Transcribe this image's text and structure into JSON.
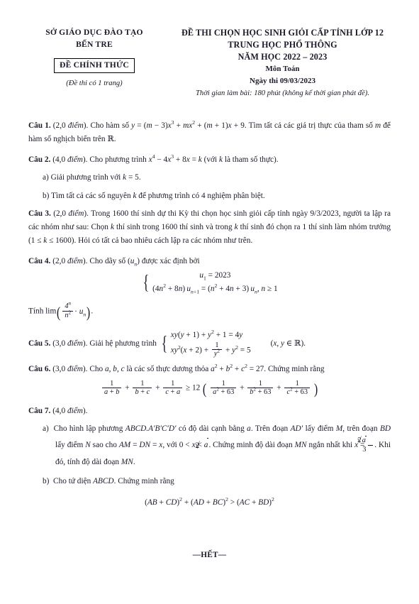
{
  "header": {
    "dept_line1": "SỞ GIÁO DỤC ĐÀO TẠO",
    "dept_line2": "BẾN TRE",
    "official_badge": "ĐỀ CHÍNH THỨC",
    "pages_note": "(Đề thi có 1 trang)",
    "exam_line1": "ĐỀ THI CHỌN HỌC SINH GIỎI CẤP TỈNH LỚP 12",
    "exam_line2": "TRUNG HỌC PHỔ THÔNG",
    "school_year": "NĂM HỌC 2022 – 2023",
    "subject": "Môn Toán",
    "exam_date": "Ngày thi 09/03/2023",
    "duration_note": "Thời gian làm bài: 180 phút (không kể thời gian phát đề)."
  },
  "questions": {
    "q1": {
      "label": "Câu 1.",
      "points": "(2,0 điểm).",
      "text_a": "Cho hàm số",
      "formula": "y = (m − 3)x³ + mx² + (m + 1)x + 9.",
      "text_b": "Tìm tất cả các giá trị thực của tham số m để hàm số nghịch biến trên ℝ."
    },
    "q2": {
      "label": "Câu 2.",
      "points": "(4,0 điểm).",
      "text_a": "Cho phương trình",
      "formula": "x⁴ − 4x³ + 8x = k",
      "text_b": "(với k là tham số thực).",
      "a": "a) Giải phương trình với k = 5.",
      "b": "b) Tìm tất cả các số nguyên k để phương trình có 4 nghiệm phân biệt."
    },
    "q3": {
      "label": "Câu 3.",
      "points": "(2,0 điểm).",
      "text": "Trong 1600 thí sinh dự thi Kỳ thi chọn học sinh giỏi cấp tỉnh ngày 9/3/2023, người ta lập ra các nhóm như sau: Chọn k thí sinh trong 1600 thí sinh và trong k thí sinh đó chọn ra 1 thí sinh làm nhóm trưởng (1 ≤ k ≤ 1600). Hỏi có tất cả bao nhiêu cách lập ra các nhóm như trên."
    },
    "q4": {
      "label": "Câu 4.",
      "points": "(2,0 điểm).",
      "text": "Cho dãy số (uₙ) được xác định bởi",
      "system_row1": "u₁ = 2023",
      "system_row2": "(4n² + 8n) uₙ₊₁ = (n² + 4n + 3) uₙ, n ≥ 1",
      "limit_prompt": "Tính lim",
      "limit_expr": "(4ⁿ / n² · uₙ)."
    },
    "q5": {
      "label": "Câu 5.",
      "points": "(3,0 điểm).",
      "text": "Giải hệ phương trình",
      "system_row1": "xy(y + 1) + y² + 1 = 4y",
      "system_row2": "xy²(x + 2) + 1/y² + y² = 5",
      "domain": "(x, y ∈ ℝ)."
    },
    "q6": {
      "label": "Câu 6.",
      "points": "(3,0 điểm).",
      "text": "Cho a, b, c là các số thực dương thỏa a² + b² + c² = 27. Chứng minh rằng",
      "inequality": "1/(a+b) + 1/(b+c) + 1/(c+a) ≥ 12 ( 1/(a²+63) + 1/(b²+63) + 1/(c²+63) )"
    },
    "q7": {
      "label": "Câu 7.",
      "points": "(4,0 điểm).",
      "a_text": "a) Cho hình lập phương ABCD.A′B′C′D′ có độ dài cạnh bằng a. Trên đoạn AD′ lấy điểm M, trên đoạn BD lấy điểm N sao cho AM = DN = x, với 0 < x < a√2. Chứng minh độ dài đoạn MN ngắn nhất khi x = a√2/3. Khi đó, tính độ dài đoạn MN.",
      "b_text": "b) Cho tứ diện ABCD. Chứng minh rằng",
      "b_formula": "(AB + CD)² + (AD + BC)² > (AC + BD)²"
    }
  },
  "footer": {
    "end_mark": "—HẾT—"
  },
  "colors": {
    "text": "#1a1a28",
    "background": "#ffffff",
    "rule": "#000000"
  }
}
